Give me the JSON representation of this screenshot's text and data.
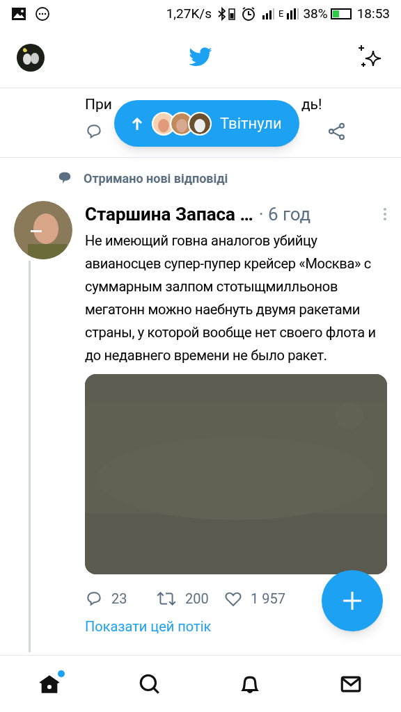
{
  "status_bar": {
    "speed": "1,27K/s",
    "network": "E",
    "battery": "38%",
    "time": "18:53"
  },
  "previous_tweet": {
    "text_start": "При",
    "text_end": "дь!"
  },
  "new_tweets_pill": {
    "label": "Твітнули"
  },
  "reply_notice": "Отримано нові відповіді",
  "tweet": {
    "author": "Старшина Запаса …",
    "time": "· 6 год",
    "text": "Не имеющий говна аналогов убийцу авианосцев супер-пупер крейсер «Москва» с суммарным залпом стотыщмилльонов мегатонн можно наебнуть двумя ракетами страны, у которой вообще нет своего флота и до недавнего времени не было ракет.",
    "replies": "23",
    "retweets": "200",
    "likes": "1 957"
  },
  "show_thread": "Показати цей потік",
  "bottom_nav": [
    {
      "kind": "home",
      "selected": true,
      "badge": true
    },
    {
      "kind": "search",
      "selected": false,
      "badge": false
    },
    {
      "kind": "notifications",
      "selected": false,
      "badge": false
    },
    {
      "kind": "messages",
      "selected": false,
      "badge": false
    }
  ]
}
